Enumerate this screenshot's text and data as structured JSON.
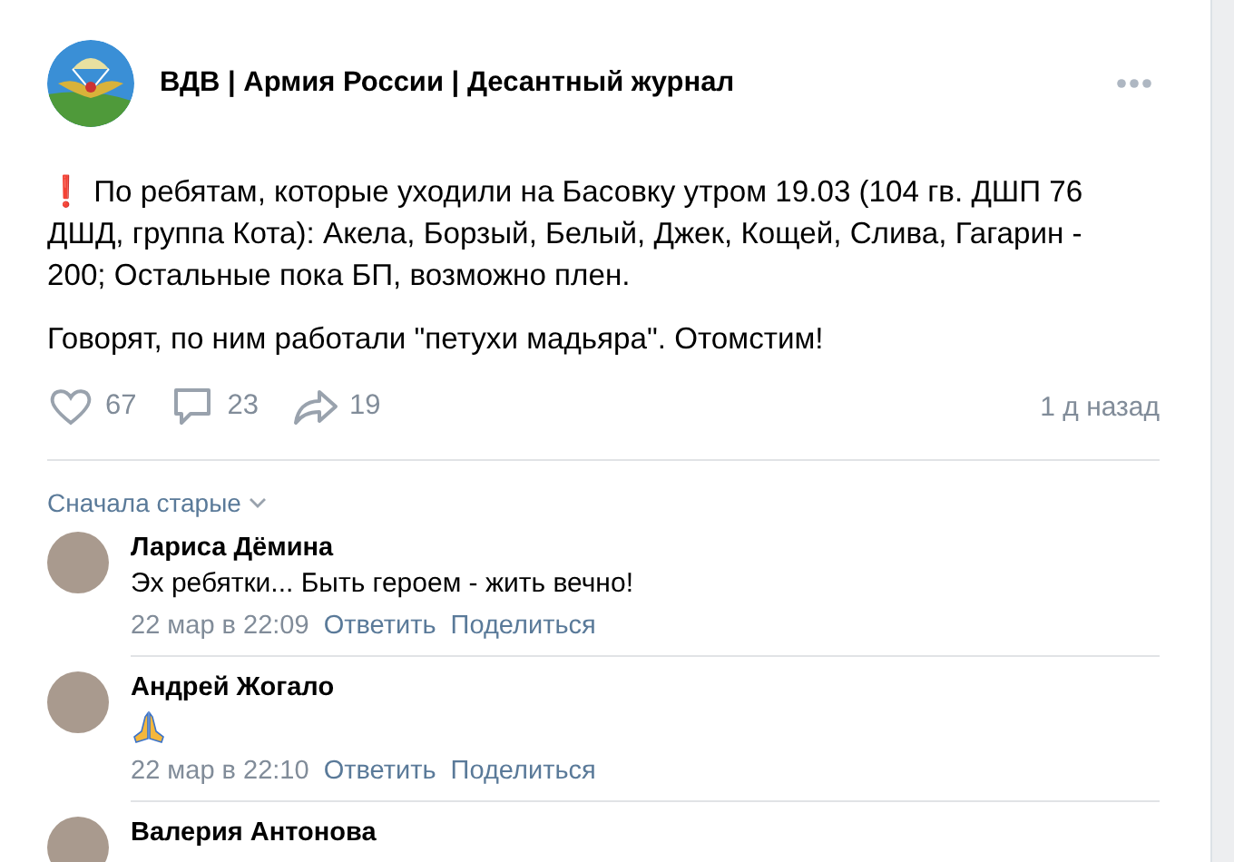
{
  "post": {
    "author": "ВДВ | Армия России | Десантный журнал",
    "paragraphs": [
      "❗ По ребятам, которые уходили на Басовку утром 19.03 (104 гв. ДШП 76 ДШД, группа Кота): Акела, Борзый, Белый, Джек, Кощей, Слива, Гагарин - 200; Остальные пока БП, возможно плен.",
      "Говорят, по ним работали \"петухи мадьяра\". Отомстим!"
    ],
    "actions": [
      {
        "kind": "like",
        "count": "67"
      },
      {
        "kind": "comment",
        "count": "23"
      },
      {
        "kind": "share",
        "count": "19"
      }
    ],
    "time": "1 д назад"
  },
  "comments_sort": "Сначала старые",
  "comments": [
    {
      "author": "Лариса Дёмина",
      "kind": "text",
      "text": "Эх ребятки... Быть героем - жить вечно!",
      "date": "22 мар в 22:09",
      "reply": "Ответить",
      "share": "Поделиться"
    },
    {
      "author": "Андрей Жогало",
      "kind": "emoji",
      "date": "22 мар в 22:10",
      "reply": "Ответить",
      "share": "Поделиться"
    },
    {
      "author": "Валерия Антонова",
      "kind": "cut"
    }
  ]
}
